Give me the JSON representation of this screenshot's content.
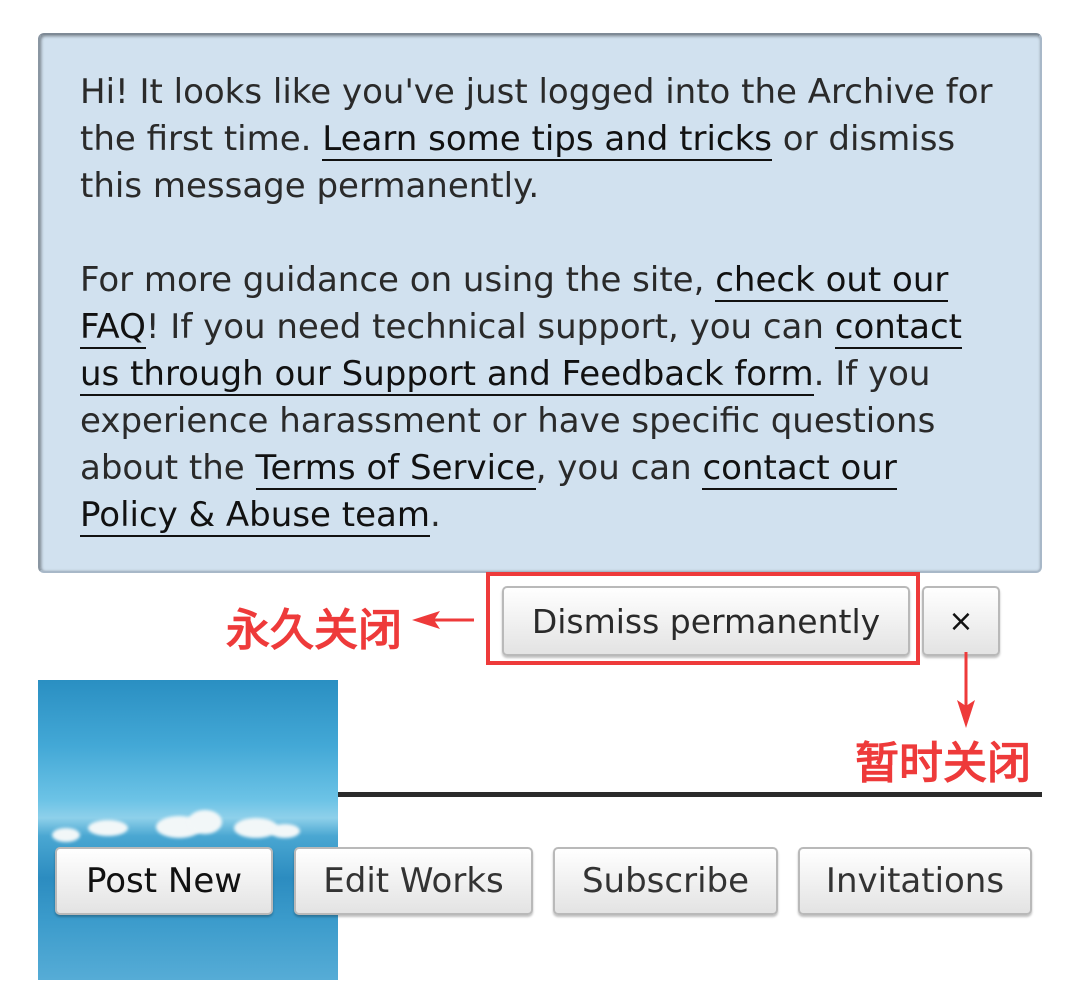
{
  "notice": {
    "para1": {
      "text_before": "Hi! It looks like you've just logged into the Archive for the first time. ",
      "link_tips": "Learn some tips and tricks",
      "text_after": " or dismiss this message permanently."
    },
    "para2": {
      "text_1": "For more guidance on using the site, ",
      "link_faq": "check out our FAQ",
      "text_2": "! If you need technical support, you can ",
      "link_support": "contact us through our Support and Feedback form",
      "text_3": ". If you experience harassment or have specific questions about the ",
      "link_tos": "Terms of Service",
      "text_4": ", you can ",
      "link_policy": "contact our Policy & Abuse team",
      "text_5": "."
    }
  },
  "buttons": {
    "dismiss_label": "Dismiss permanently",
    "close_label": "×"
  },
  "annotations": {
    "left_label": "永久关闭",
    "right_label": "暂时关闭",
    "color": "#ee3a3a"
  },
  "nav": {
    "post_new": "Post New",
    "edit_works": "Edit Works",
    "subscribe": "Subscribe",
    "invitations": "Invitations"
  },
  "colors": {
    "notice_bg": "#d1e1ef",
    "highlight": "#ee3a3a"
  }
}
